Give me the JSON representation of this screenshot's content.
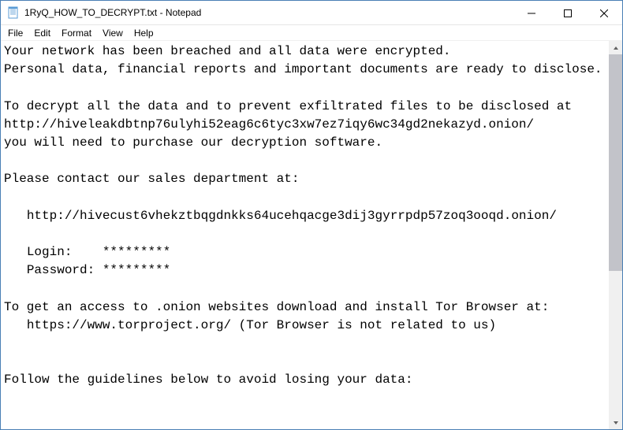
{
  "window": {
    "title": "1RyQ_HOW_TO_DECRYPT.txt - Notepad"
  },
  "menubar": {
    "items": [
      "File",
      "Edit",
      "Format",
      "View",
      "Help"
    ]
  },
  "content": {
    "text": "Your network has been breached and all data were encrypted.\nPersonal data, financial reports and important documents are ready to disclose.\n\nTo decrypt all the data and to prevent exfiltrated files to be disclosed at\nhttp://hiveleakdbtnp76ulyhi52eag6c6tyc3xw7ez7iqy6wc34gd2nekazyd.onion/\nyou will need to purchase our decryption software.\n\nPlease contact our sales department at:\n\n   http://hivecust6vhekztbqgdnkks64ucehqacge3dij3gyrrpdp57zoq3ooqd.onion/\n\n   Login:    *********\n   Password: *********\n\nTo get an access to .onion websites download and install Tor Browser at:\n   https://www.torproject.org/ (Tor Browser is not related to us)\n\n\nFollow the guidelines below to avoid losing your data:"
  }
}
